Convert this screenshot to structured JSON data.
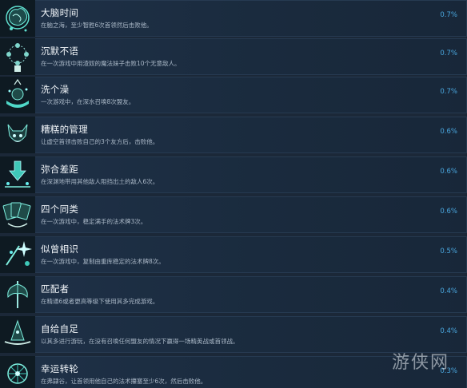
{
  "achievements": [
    {
      "title": "大脑时间",
      "desc": "在脑之海，至少智胜6次首领然后击败他。",
      "pct": "0.7%",
      "icon": "brain-icon"
    },
    {
      "title": "沉默不语",
      "desc": "在一次游戏中用渣奴的魔法妹子击败10个无意敌人。",
      "pct": "0.7%",
      "icon": "rosary-icon"
    },
    {
      "title": "洗个澡",
      "desc": "一次游戏中，在深水召唤8次盟友。",
      "pct": "0.7%",
      "icon": "bath-icon"
    },
    {
      "title": "糟糕的管理",
      "desc": "让虚空首领击败自己的3个友方后，击败他。",
      "pct": "0.6%",
      "icon": "demon-icon"
    },
    {
      "title": "弥合差距",
      "desc": "在深渊地带用其他敌人阻挡出土的敌人6次。",
      "pct": "0.6%",
      "icon": "arrow-down-icon"
    },
    {
      "title": "四个同类",
      "desc": "在一次游戏中，稳定满手的法术牌3次。",
      "pct": "0.6%",
      "icon": "cards-icon"
    },
    {
      "title": "似曾相识",
      "desc": "在一次游戏中，复制由重库稳定的法术牌8次。",
      "pct": "0.5%",
      "icon": "spark-icon"
    },
    {
      "title": "匹配者",
      "desc": "在精通6或者更高等级下使用其多完成游戏。",
      "pct": "0.4%",
      "icon": "axe-icon"
    },
    {
      "title": "自给自足",
      "desc": "以其多进行游玩，在没有召唤任何盟友的情况下赢得一场精英战或首领战。",
      "pct": "0.4%",
      "icon": "witch-hat-icon"
    },
    {
      "title": "幸运转轮",
      "desc": "在弗隸谷，让首领用他自己的法术攥塞至少6次，然后击败他。",
      "pct": "0.3%",
      "icon": "wheel-icon"
    }
  ],
  "watermark": "游侠网"
}
